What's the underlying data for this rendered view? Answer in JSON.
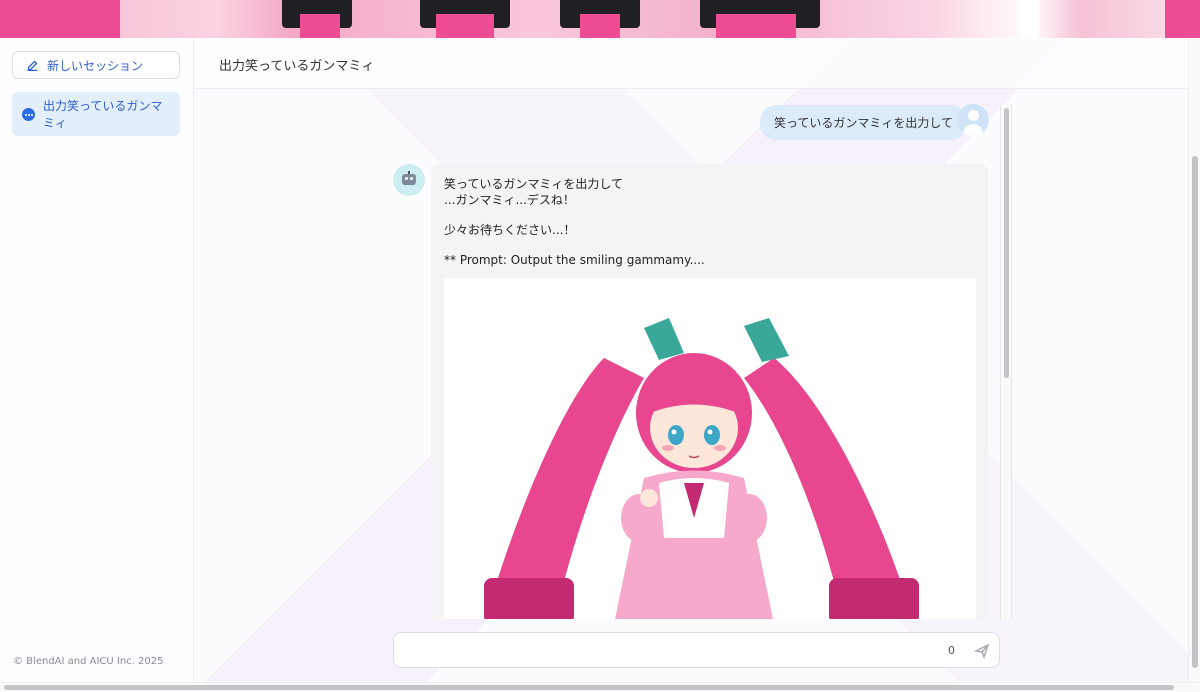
{
  "sidebar": {
    "new_session_label": "新しいセッション",
    "sessions": [
      {
        "label": "出力笑っているガンマミィ"
      }
    ],
    "copyright": "© BlendAI and AICU Inc. 2025"
  },
  "header": {
    "title": "出力笑っているガンマミィ"
  },
  "messages": {
    "user": {
      "text": "笑っているガンマミィを出力して"
    },
    "assistant": {
      "line1": "笑っているガンマミィを出力して",
      "line2": "...ガンマミィ...デスね！",
      "line3": "少々お待ちください...！",
      "line4": "** Prompt: Output the smiling gammamy...."
    }
  },
  "input": {
    "value": "",
    "char_count": "0"
  },
  "colors": {
    "accent": "#2f5fd0",
    "selected_session_bg": "#e3effb",
    "user_bubble_bg": "#dcebfa",
    "assistant_bubble_bg": "#f4f4f6"
  },
  "icons": {
    "new_session": "edit-icon",
    "session": "chat-dots-icon",
    "send": "send-icon",
    "user_avatar": "user-avatar-icon",
    "bot_avatar": "robot-icon"
  }
}
